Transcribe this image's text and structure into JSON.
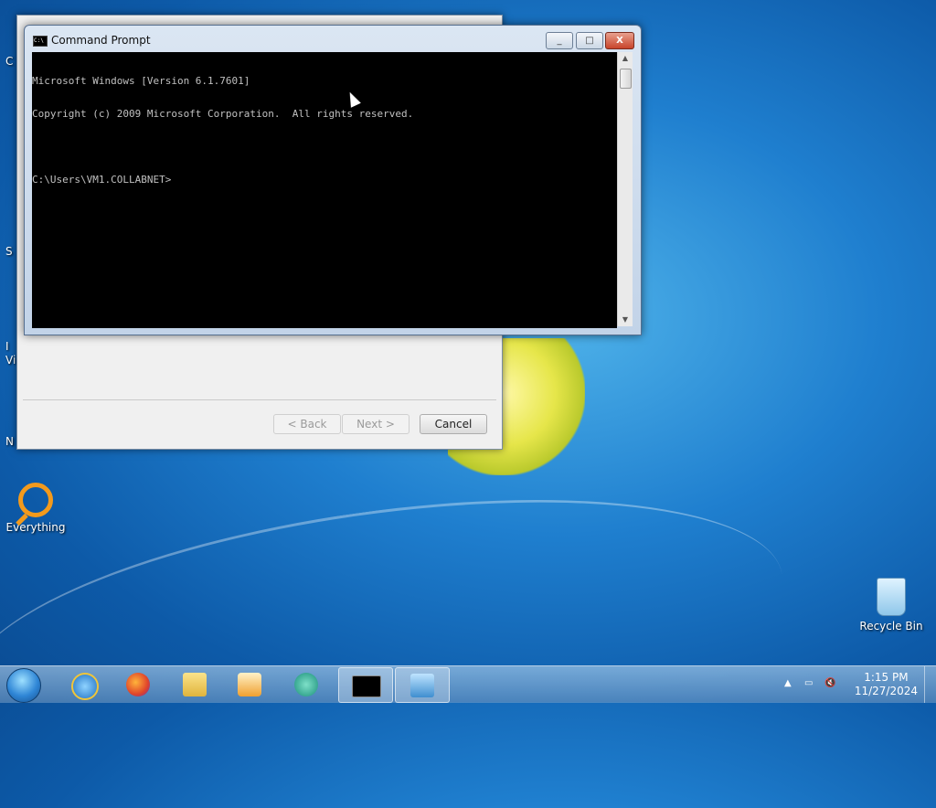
{
  "desktop": {
    "icons": {
      "everything": "Everything",
      "recycle_bin": "Recycle Bin"
    },
    "edge_labels": [
      "C",
      "S",
      "I",
      "Vi",
      "N"
    ]
  },
  "wizard": {
    "back_label": "< Back",
    "next_label": "Next >",
    "cancel_label": "Cancel"
  },
  "cmd": {
    "title": "Command Prompt",
    "icon_text": "C:\\",
    "lines": [
      "Microsoft Windows [Version 6.1.7601]",
      "Copyright (c) 2009 Microsoft Corporation.  All rights reserved.",
      ""
    ],
    "prompt": "C:\\Users\\VM1.COLLABNET>",
    "minimize": "_",
    "maximize": "□",
    "close": "X"
  },
  "taskbar": {
    "pinned": [
      "start-orb",
      "internet-explorer-icon",
      "firefox-icon",
      "file-explorer-icon",
      "media-player-icon",
      "app-icon",
      "command-prompt-icon",
      "setup-wizard-icon"
    ],
    "clock": {
      "time": "1:15 PM",
      "date": "11/27/2024"
    },
    "tray": {
      "up_arrow": "▲",
      "network": "▭",
      "volume": "🔇"
    }
  },
  "colors": {
    "console_bg": "#000000",
    "console_fg": "#c0c0c0",
    "desktop_blue": "#1f7fcf"
  }
}
